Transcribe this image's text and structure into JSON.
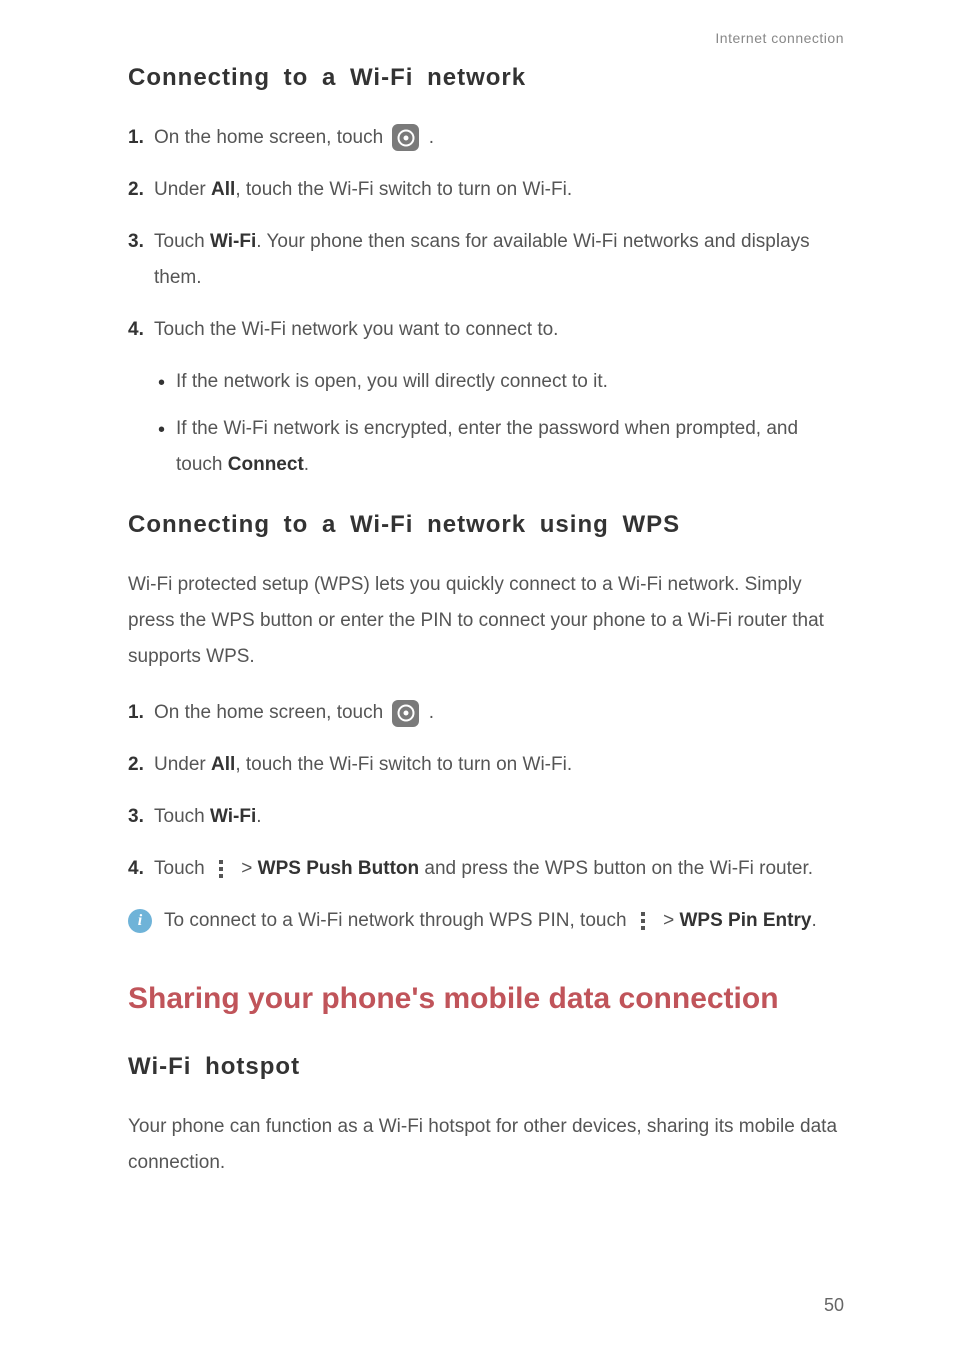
{
  "header": {
    "label": "Internet connection"
  },
  "section1": {
    "heading": "Connecting to a Wi-Fi network",
    "steps": {
      "s1": {
        "num": "1.",
        "t1": "On the home screen, touch ",
        "t2": "."
      },
      "s2": {
        "num": "2.",
        "t1": "Under ",
        "b1": "All",
        "t2": ", touch the Wi-Fi switch to turn on Wi-Fi."
      },
      "s3": {
        "num": "3.",
        "t1": "Touch ",
        "b1": "Wi-Fi",
        "t2": ". Your phone then scans for available Wi-Fi networks and displays them."
      },
      "s4": {
        "num": "4.",
        "t1": "Touch the Wi-Fi network you want to connect to."
      }
    },
    "bullets": {
      "b1": "If the network is open, you will directly connect to it.",
      "b2": {
        "t1": "If the Wi-Fi network is encrypted, enter the password when prompted, and touch ",
        "b1": "Connect",
        "t2": "."
      }
    }
  },
  "section2": {
    "heading": "Connecting to a Wi-Fi network using WPS",
    "intro": "Wi-Fi protected setup (WPS) lets you quickly connect to a Wi-Fi network. Simply press the WPS button or enter the PIN to connect your phone to a Wi-Fi router that supports WPS.",
    "steps": {
      "s1": {
        "num": "1.",
        "t1": "On the home screen, touch ",
        "t2": "."
      },
      "s2": {
        "num": "2.",
        "t1": "Under ",
        "b1": "All",
        "t2": ", touch the Wi-Fi switch to turn on Wi-Fi."
      },
      "s3": {
        "num": "3.",
        "t1": "Touch ",
        "b1": "Wi-Fi",
        "t2": "."
      },
      "s4": {
        "num": "4.",
        "t1": "Touch ",
        "gt": " > ",
        "b1": "WPS Push Button",
        "t2": " and press the WPS button on the Wi-Fi router."
      }
    },
    "info": {
      "t1": "To connect to a Wi-Fi network through WPS PIN, touch ",
      "gt": " > ",
      "b1": "WPS Pin Entry",
      "t2": "."
    }
  },
  "section3": {
    "title": "Sharing your phone's mobile data connection",
    "sub": {
      "heading": "Wi-Fi hotspot",
      "intro": "Your phone can function as a Wi-Fi hotspot for other devices, sharing its mobile data connection."
    }
  },
  "pagenum": "50"
}
